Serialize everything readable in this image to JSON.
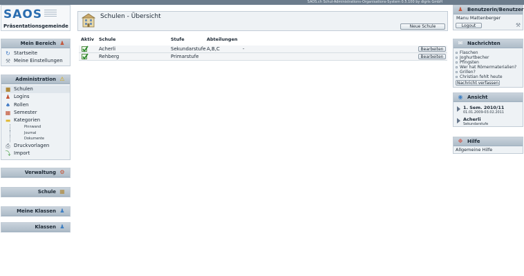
{
  "topbar": {
    "text": "SAOS.ch Schul-Administrations-Organisations-System 0.5.100 by digris GmbH"
  },
  "logo": {
    "name": "SAOS",
    "subtitle": "Präsentationsgemeinde"
  },
  "left": {
    "mein_bereich": {
      "title": "Mein Bereich",
      "items": [
        "Startseite",
        "Meine Einstellungen"
      ]
    },
    "administration": {
      "title": "Administration",
      "items": [
        "Schulen",
        "Logins",
        "Rollen",
        "Semester",
        "Kategorien"
      ],
      "kategorien_sub": [
        "Pinnwand",
        "Journal",
        "Dokumente"
      ],
      "items_after": [
        "Druckvorlagen",
        "Import"
      ]
    },
    "verwaltung": {
      "title": "Verwaltung"
    },
    "schule": {
      "title": "Schule"
    },
    "meine_klassen": {
      "title": "Meine Klassen"
    },
    "klassen": {
      "title": "Klassen"
    }
  },
  "main": {
    "title": "Schulen - Übersicht",
    "new_button": "Neue Schule",
    "columns": [
      "Aktiv",
      "Schule",
      "Stufe",
      "Abteilungen"
    ],
    "rows": [
      {
        "schule": "Acherli",
        "stufe": "Sekundarstufe",
        "abteilungen": "A,B,C",
        "extra": "-",
        "button": "Bearbeiten"
      },
      {
        "schule": "Rehberg",
        "stufe": "Primarstufe",
        "abteilungen": "",
        "extra": "",
        "button": "Bearbeiten"
      }
    ]
  },
  "right": {
    "user": {
      "title": "Benutzerin/Benutzer",
      "name": "Manu Mattenberger",
      "logout": "Logout"
    },
    "nachrichten": {
      "title": "Nachrichten",
      "items": [
        "Flaschen",
        "Joghurtbecher",
        "Pfingsten",
        "Wer hat Römermaterialien?",
        "Grillen?",
        "Christian fehlt heute"
      ],
      "button": "Nachricht verfassen"
    },
    "ansicht": {
      "title": "Ansicht",
      "entries": [
        {
          "title": "1. Sem. 2010/11",
          "sub": "01.01.2009-03.02.2011"
        },
        {
          "title": "Acherli",
          "sub": "Sekundarstufe"
        }
      ]
    },
    "hilfe": {
      "title": "Hilfe",
      "link": "Allgemeine Hilfe"
    }
  }
}
